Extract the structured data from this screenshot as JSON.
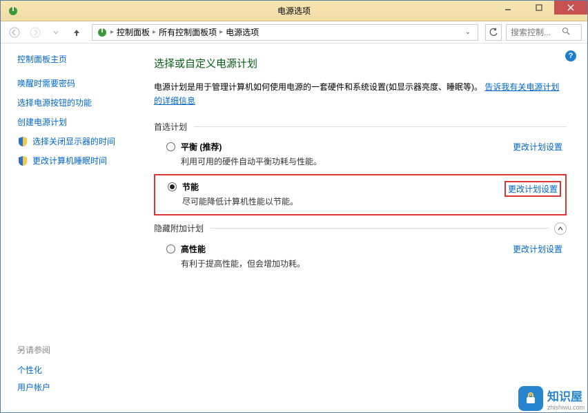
{
  "window": {
    "title": "电源选项"
  },
  "breadcrumb": {
    "items": [
      "控制面板",
      "所有控制面板项",
      "电源选项"
    ]
  },
  "search": {
    "placeholder": "搜索控制..."
  },
  "sidebar": {
    "home": "控制面板主页",
    "links": [
      "唤醒时需要密码",
      "选择电源按钮的功能",
      "创建电源计划",
      "选择关闭显示器的时间",
      "更改计算机睡眠时间"
    ],
    "see_also_heading": "另请参阅",
    "see_also": [
      "个性化",
      "用户帐户"
    ]
  },
  "main": {
    "heading": "选择或自定义电源计划",
    "desc_prefix": "电源计划是用于管理计算机如何使用电源的一套硬件和系统设置(如显示器亮度、睡眠等)。",
    "desc_link": "告诉我有关电源计划的详细信息",
    "group1_label": "首选计划",
    "group2_label": "隐藏附加计划",
    "edit_label": "更改计划设置",
    "plans": [
      {
        "name": "平衡 (推荐)",
        "desc": "利用可用的硬件自动平衡功耗与性能。",
        "checked": false,
        "highlight": false
      },
      {
        "name": "节能",
        "desc": "尽可能降低计算机性能以节能。",
        "checked": true,
        "highlight": true
      }
    ],
    "hidden_plans": [
      {
        "name": "高性能",
        "desc": "有利于提高性能，但会增加功耗。",
        "checked": false,
        "highlight": false
      }
    ]
  },
  "watermark": {
    "big": "知识屋",
    "small": "zhishiwu.com"
  },
  "help": "?"
}
